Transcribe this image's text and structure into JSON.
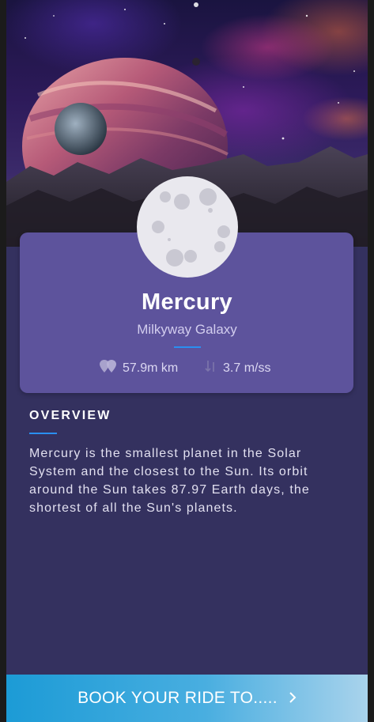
{
  "planet": {
    "name": "Mercury",
    "galaxy": "Milkyway Galaxy",
    "distance": "57.9m km",
    "gravity": "3.7 m/ss"
  },
  "overview": {
    "heading": "OVERVIEW",
    "text": "Mercury is the smallest planet in the Solar System and the closest to the Sun. Its orbit around the Sun takes 87.97 Earth days, the shortest of all the Sun's planets."
  },
  "cta": {
    "label": "BOOK YOUR RIDE TO....."
  },
  "icons": {
    "distance": "location-pins-icon",
    "gravity": "gravity-arrows-icon",
    "cta": "chevron-right-icon"
  },
  "colors": {
    "background": "#34315f",
    "card": "#5d539c",
    "accent": "#2a8ff0",
    "cta_start": "#1c9bd6",
    "cta_end": "#a9d3ec"
  }
}
